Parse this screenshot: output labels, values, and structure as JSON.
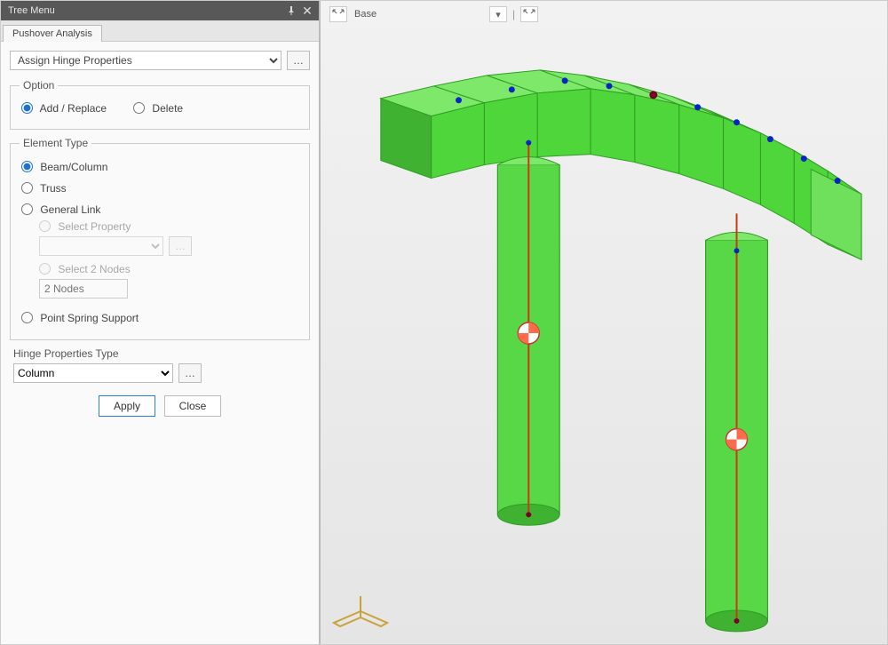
{
  "panel": {
    "title": "Tree Menu",
    "tab": "Pushover Analysis",
    "function_select": "Assign Hinge Properties",
    "option": {
      "legend": "Option",
      "add_replace": "Add / Replace",
      "delete": "Delete",
      "selected": "add_replace"
    },
    "element_type": {
      "legend": "Element Type",
      "beam_column": "Beam/Column",
      "truss": "Truss",
      "general_link": "General Link",
      "select_property": "Select Property",
      "select_2_nodes": "Select 2 Nodes",
      "two_nodes_placeholder": "2 Nodes",
      "point_spring": "Point Spring Support",
      "selected": "beam_column"
    },
    "hinge": {
      "label": "Hinge Properties Type",
      "value": "Column"
    },
    "buttons": {
      "apply": "Apply",
      "close": "Close"
    }
  },
  "viewport": {
    "view_label": "Base",
    "colors": {
      "slab_face": "#4fd63a",
      "slab_edge": "#2f9e22",
      "slab_top": "#7ee86a",
      "column": "#58d846",
      "column_dark": "#3fb231",
      "node": "#0026c2",
      "hinge_a": "#ff5c3a",
      "hinge_b": "#ffffff"
    }
  }
}
